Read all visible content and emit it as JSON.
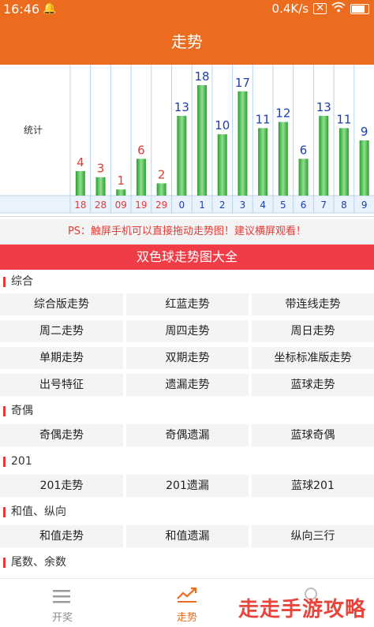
{
  "status_bar": {
    "time": "16:46",
    "network_speed": "0.4K/s"
  },
  "header": {
    "title": "走势"
  },
  "chart_data": {
    "type": "bar",
    "ylabel": "统计",
    "categories": [
      "18",
      "28",
      "09",
      "19",
      "29",
      "0",
      "1",
      "2",
      "3",
      "4",
      "5",
      "6",
      "7",
      "8",
      "9"
    ],
    "values": [
      4,
      3,
      1,
      6,
      2,
      13,
      18,
      10,
      17,
      11,
      12,
      6,
      13,
      11,
      9
    ],
    "highlight_colors": [
      "#e53935",
      "#e53935",
      "#e53935",
      "#e53935",
      "#e53935",
      "#1a3fb0",
      "#1a3fb0",
      "#1a3fb0",
      "#1a3fb0",
      "#1a3fb0",
      "#1a3fb0",
      "#1a3fb0",
      "#1a3fb0",
      "#1a3fb0",
      "#1a3fb0"
    ]
  },
  "notice": {
    "text": "PS：触屏手机可以直接拖动走势图！建议横屏观看！"
  },
  "banner": {
    "title": "双色球走势图大全"
  },
  "sections": [
    {
      "title": "综合",
      "items": [
        "综合版走势",
        "红蓝走势",
        "带连线走势",
        "周二走势",
        "周四走势",
        "周日走势",
        "单期走势",
        "双期走势",
        "坐标标准版走势",
        "出号特征",
        "遗漏走势",
        "蓝球走势"
      ]
    },
    {
      "title": "奇偶",
      "items": [
        "奇偶走势",
        "奇偶遗漏",
        "蓝球奇偶"
      ]
    },
    {
      "title": "201",
      "items": [
        "201走势",
        "201遗漏",
        "蓝球201"
      ]
    },
    {
      "title": "和值、纵向",
      "items": [
        "和值走势",
        "和值遗漏",
        "纵向三行"
      ]
    },
    {
      "title": "尾数、余数",
      "items": []
    }
  ],
  "tabbar": {
    "tabs": [
      {
        "label": "开奖",
        "icon": "list-icon"
      },
      {
        "label": "走势",
        "icon": "trend-chart-icon"
      },
      {
        "label": "",
        "icon": "search-icon"
      }
    ]
  },
  "watermark": {
    "text": "走走手游攻略"
  },
  "colors": {
    "accent": "#ec6c1f",
    "banner": "#ef3c47",
    "bar_green": "#3cb93c",
    "red_text": "#e53935",
    "blue_text": "#1a3fb0"
  }
}
